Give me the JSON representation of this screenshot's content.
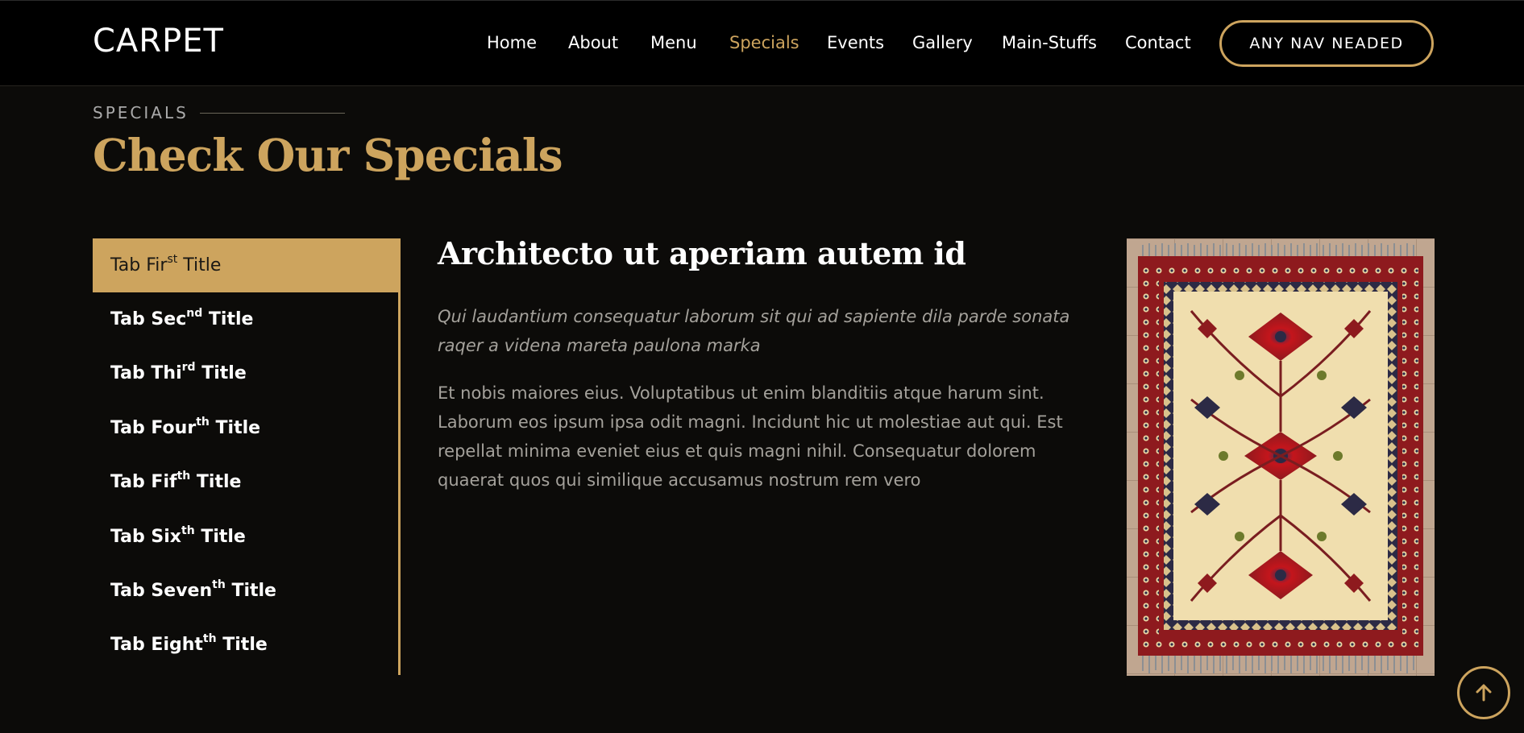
{
  "header": {
    "logo": "CARPET",
    "nav": [
      {
        "label": "Home",
        "active": false
      },
      {
        "label": "About",
        "active": false
      },
      {
        "label": "Menu",
        "active": false
      },
      {
        "label": "Specials",
        "active": true
      },
      {
        "label": "Events",
        "active": false
      },
      {
        "label": "Gallery",
        "active": false
      },
      {
        "label": "Main-Stuffs",
        "active": false
      },
      {
        "label": "Contact",
        "active": false
      }
    ],
    "cta": "ANY NAV NEADED"
  },
  "section": {
    "kicker": "SPECIALS",
    "title": "Check Our Specials"
  },
  "tabs": [
    {
      "prefix": "Tab Fir",
      "sup": "st",
      "suffix": " Title",
      "active": true
    },
    {
      "prefix": "Tab Sec",
      "sup": "nd",
      "suffix": " Title",
      "active": false
    },
    {
      "prefix": "Tab Thi",
      "sup": "rd",
      "suffix": " Title",
      "active": false
    },
    {
      "prefix": "Tab Four",
      "sup": "th",
      "suffix": " Title",
      "active": false
    },
    {
      "prefix": "Tab Fif",
      "sup": "th",
      "suffix": " Title",
      "active": false
    },
    {
      "prefix": "Tab Six",
      "sup": "th",
      "suffix": " Title",
      "active": false
    },
    {
      "prefix": "Tab Seven",
      "sup": "th",
      "suffix": " Title",
      "active": false
    },
    {
      "prefix": "Tab Eight",
      "sup": "th",
      "suffix": " Title",
      "active": false
    }
  ],
  "content": {
    "title": "Architecto ut aperiam autem id",
    "italic": "Qui laudantium consequatur laborum sit qui ad sapiente dila parde sonata raqer a videna mareta paulona marka",
    "body": "Et nobis maiores eius. Voluptatibus ut enim blanditiis atque harum sint. Laborum eos ipsum ipsa odit magni. Incidunt hic ut molestiae aut qui. Est repellat minima eveniet eius et quis magni nihil. Consequatur dolorem quaerat quos qui similique accusamus nostrum rem vero"
  },
  "icons": {
    "back_to_top": "arrow-up-icon",
    "specials_image": "carpet-image"
  },
  "colors": {
    "accent": "#cda45e",
    "background": "#0c0b09",
    "header": "#000000",
    "muted_text": "#a4a19b"
  }
}
